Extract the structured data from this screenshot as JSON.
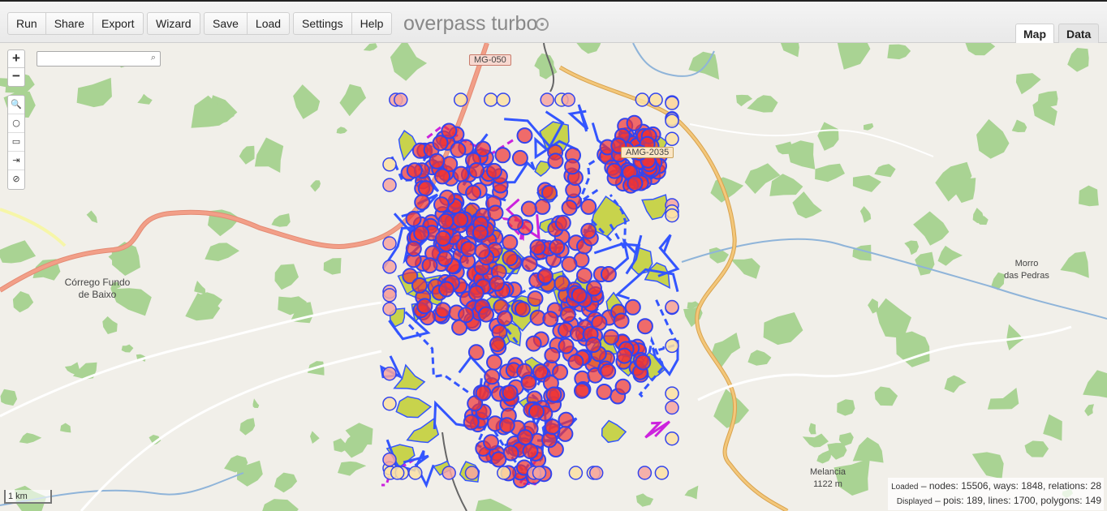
{
  "toolbar": {
    "buttons": [
      {
        "label": "Run"
      },
      {
        "label": "Share"
      },
      {
        "label": "Export"
      },
      {
        "label": "Wizard"
      },
      {
        "label": "Save"
      },
      {
        "label": "Load"
      },
      {
        "label": "Settings"
      },
      {
        "label": "Help"
      }
    ],
    "logo": "overpass turbo",
    "tabs": {
      "map": "Map",
      "data": "Data"
    }
  },
  "map": {
    "zoom": {
      "in": "+",
      "out": "−"
    },
    "search": {
      "placeholder": "",
      "value": ""
    },
    "tools": [
      "🔍",
      "○",
      "▭",
      "⇥",
      "⊘"
    ],
    "scale": "1 km",
    "places": [
      {
        "name": "Córrego Fundo\nde Baixo"
      },
      {
        "name": "Morro\ndas Pedras"
      },
      {
        "name": "Melancia\n1122 m"
      }
    ],
    "roads": {
      "mg050": "MG-050",
      "amg": "AMG-2035"
    },
    "stats": {
      "loaded_prefix": "Loaded",
      "loaded_text": "– nodes: 15506, ways: 1848, relations: 28",
      "displayed_prefix": "Displayed",
      "displayed_text": "– pois: 189, lines: 1700, polygons: 149"
    }
  },
  "colors": {
    "poi_fill": "#ee3333",
    "poi_stroke": "#3344ee",
    "line": "#3355ff",
    "polygon_fill": "#c8d34c",
    "forest": "#a9d393",
    "major_road": "#f29f88",
    "secondary_road": "#f3c77a",
    "water": "#8fb4d9"
  }
}
